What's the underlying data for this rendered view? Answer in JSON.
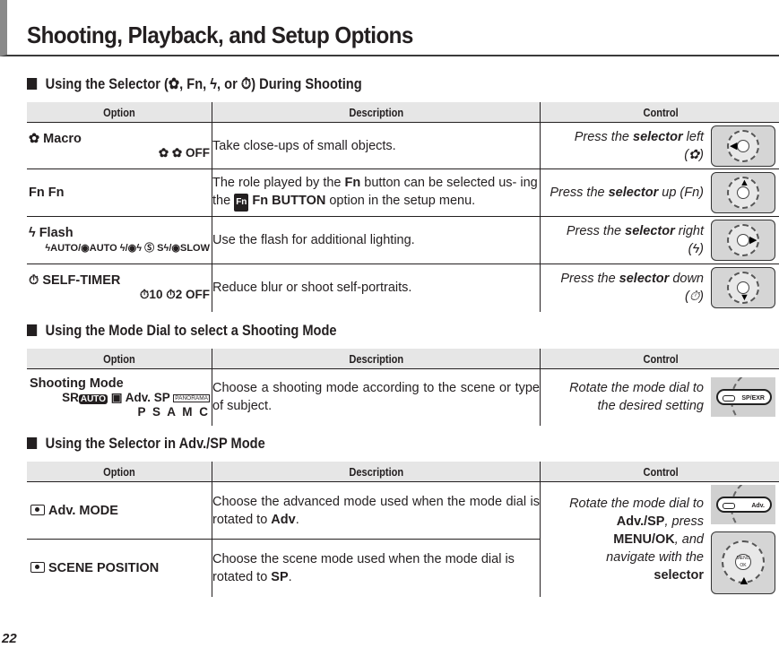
{
  "page": {
    "title": "Shooting, Playback, and Setup Options",
    "page_number": "22"
  },
  "sections": [
    {
      "heading": "Using the Selector (✿, Fn, ϟ, or ⏱) During Shooting",
      "columns": [
        "Option",
        "Description",
        "Control"
      ],
      "rows": [
        {
          "icon": "macro-icon",
          "option": "✿ Macro",
          "sub": "✿  ✿ OFF",
          "description": "Take close-ups of small objects.",
          "control_pre": "Press the ",
          "control_bold": "selector",
          "control_post": " left (✿)",
          "arrow": "◀"
        },
        {
          "icon": "fn-icon",
          "option": "Fn Fn",
          "sub": "",
          "description_pre": "The role played by the ",
          "description_bold1": "Fn",
          "description_mid": " button can be selected us- ing the ",
          "description_badge": "Fn",
          "description_bold2": " Fn BUTTON",
          "description_post": " option in the setup menu.",
          "control_pre": "Press the ",
          "control_bold": "selector",
          "control_post": " up (Fn)",
          "arrow": "▲"
        },
        {
          "icon": "flash-icon",
          "option": "ϟ Flash",
          "sub": "ϟAUTO/◉AUTO ϟ/◉ϟ Ⓢ Sϟ/◉SLOW",
          "description": "Use the flash for additional lighting.",
          "control_pre": "Press the ",
          "control_bold": "selector",
          "control_post": " right (ϟ)",
          "arrow": "▶"
        },
        {
          "icon": "self-timer-icon",
          "option": "⏱ SELF-TIMER",
          "sub": "⏱10 ⏱2 OFF",
          "description": "Reduce blur or shoot self-portraits.",
          "control_pre": "Press the ",
          "control_bold": "selector",
          "control_post": " down (⏱)",
          "arrow": "▼"
        }
      ]
    },
    {
      "heading": "Using the Mode Dial to select a Shooting Mode",
      "columns": [
        "Option",
        "Description",
        "Control"
      ],
      "rows": [
        {
          "option": "Shooting Mode",
          "sub_sr": "SR",
          "sub_auto": "AUTO",
          "sub_mid": " ▣ Adv. SP ",
          "sub_pano": "PANORAMA",
          "sub2": "P S A M C",
          "description": "Choose a shooting mode according to the scene or type of subject.",
          "control": "Rotate the mode dial to the desired setting",
          "dial_label": "SP/EXR"
        }
      ]
    },
    {
      "heading": "Using the Selector in Adv./SP Mode",
      "columns": [
        "Option",
        "Description",
        "Control"
      ],
      "rows": [
        {
          "option": "Adv. MODE",
          "description_pre": "Choose the advanced mode used when the mode dial is rotated to ",
          "description_bold": "Adv",
          "description_post": "."
        },
        {
          "option": "SCENE POSITION",
          "description_pre": "Choose the scene mode used when the mode dial is rotated to ",
          "description_bold": "SP",
          "description_post": "."
        }
      ],
      "control": {
        "t1": "Rotate the mode dial to ",
        "b1": "Adv./SP",
        "t2": ", press ",
        "b2": "MENU/OK",
        "t3": ", and navigate with the ",
        "b3": "selector",
        "dial_label": "Adv.",
        "button_label": "MENU OK"
      }
    }
  ]
}
